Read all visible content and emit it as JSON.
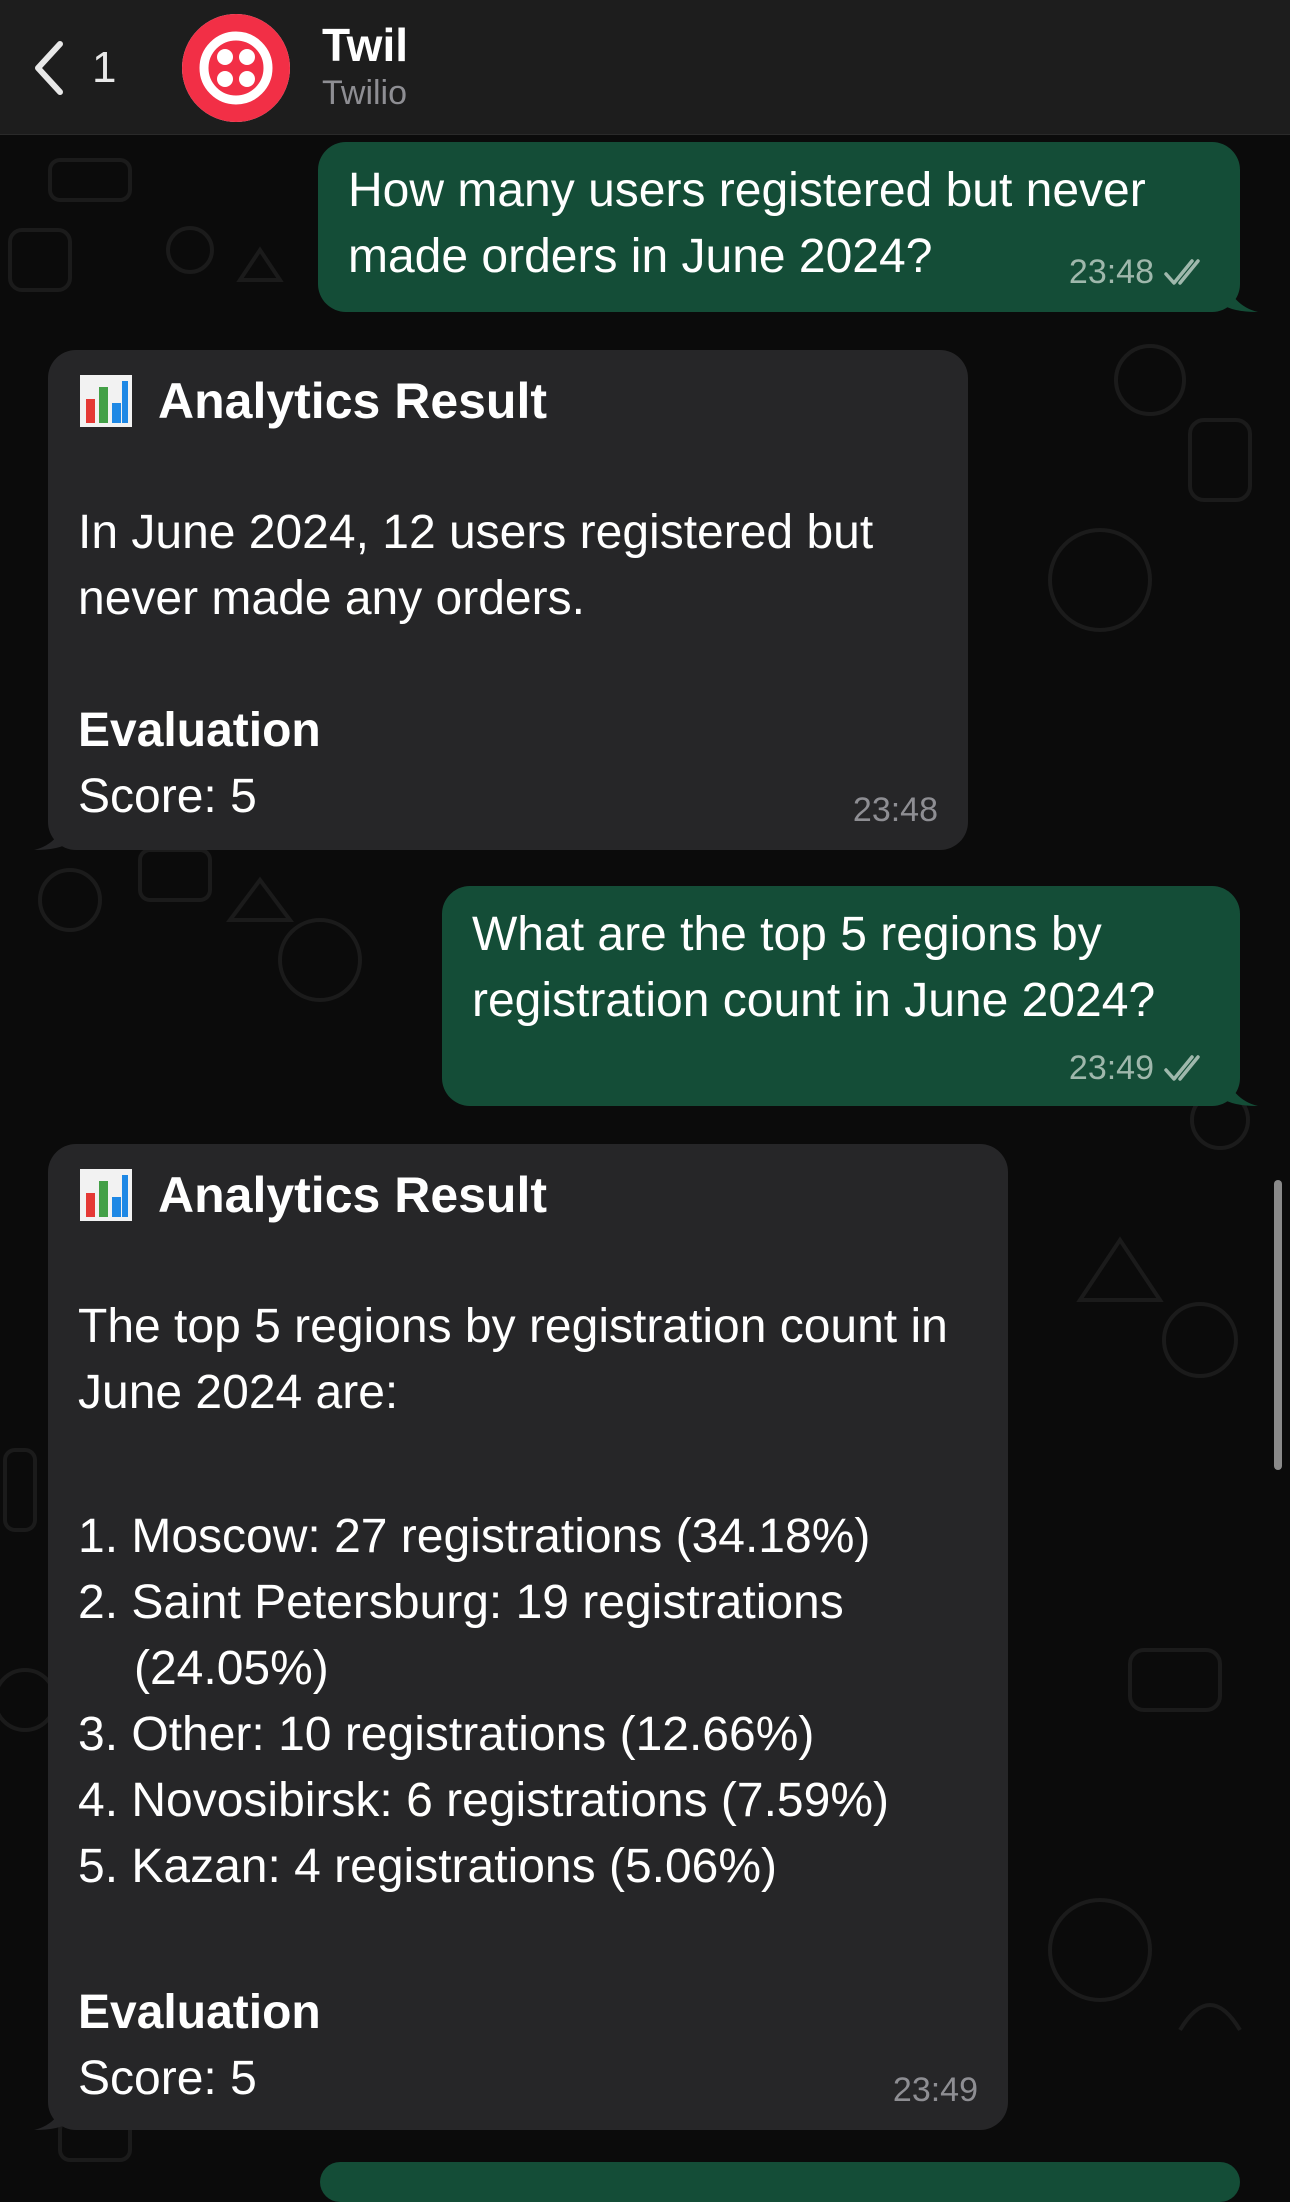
{
  "header": {
    "back_count": "1",
    "name": "Twil",
    "subtitle": "Twilio"
  },
  "messages": [
    {
      "direction": "out",
      "text": "How many users registered but never made orders in June 2024?",
      "time": "23:48"
    },
    {
      "direction": "in",
      "title_icon": "bar-chart-icon",
      "title": "Analytics Result",
      "body": "In June 2024, 12 users registered but never made any orders.",
      "eval_heading": "Evaluation",
      "eval_score": "Score: 5",
      "time": "23:48"
    },
    {
      "direction": "out",
      "text": "What are the top 5 regions by registration count in June 2024?",
      "time": "23:49"
    },
    {
      "direction": "in",
      "title_icon": "bar-chart-icon",
      "title": "Analytics Result",
      "body": "The top 5 regions by registration count in June 2024 are:",
      "list": [
        "1. Moscow: 27 registrations (34.18%)",
        "2. Saint Petersburg: 19 registrations (24.05%)",
        "3. Other: 10 registrations (12.66%)",
        "4. Novosibirsk: 6 registrations (7.59%)",
        "5. Kazan: 4 registrations (5.06%)"
      ],
      "eval_heading": "Evaluation",
      "eval_score": "Score: 5",
      "time": "23:49"
    }
  ],
  "colors": {
    "outgoing_bubble": "#144d37",
    "incoming_bubble": "#262628",
    "header": "#1d1d1d",
    "twilio_red": "#f22f46"
  }
}
